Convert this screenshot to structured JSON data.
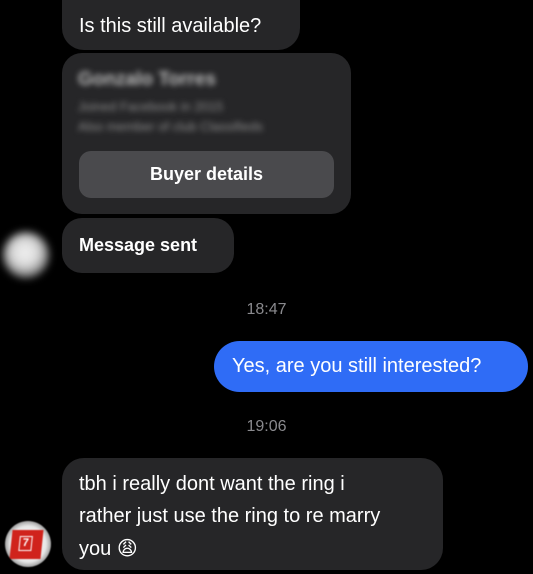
{
  "messages": {
    "question": "Is this still available?",
    "buyer_card": {
      "name": "Gonzalo Torres",
      "line1": "Joined Facebook in 2015",
      "line2": "Also member of club Classifieds",
      "button_label": "Buyer details"
    },
    "sent_label": "Message sent",
    "time_1": "18:47",
    "outgoing": "Yes, are you still interested?",
    "time_2": "19:06",
    "reply_line1": "tbh i really dont want the ring i",
    "reply_line2": "rather just use the ring to re marry",
    "reply_line3": "you",
    "reply_emoji": "😩"
  },
  "badge": {
    "text": "7",
    "color": "#d0231c"
  },
  "colors": {
    "incoming_bubble": "#262628",
    "outgoing_bubble": "#2f6cf6",
    "button": "#4a4a4d",
    "timestamp": "#8a8a8e"
  }
}
